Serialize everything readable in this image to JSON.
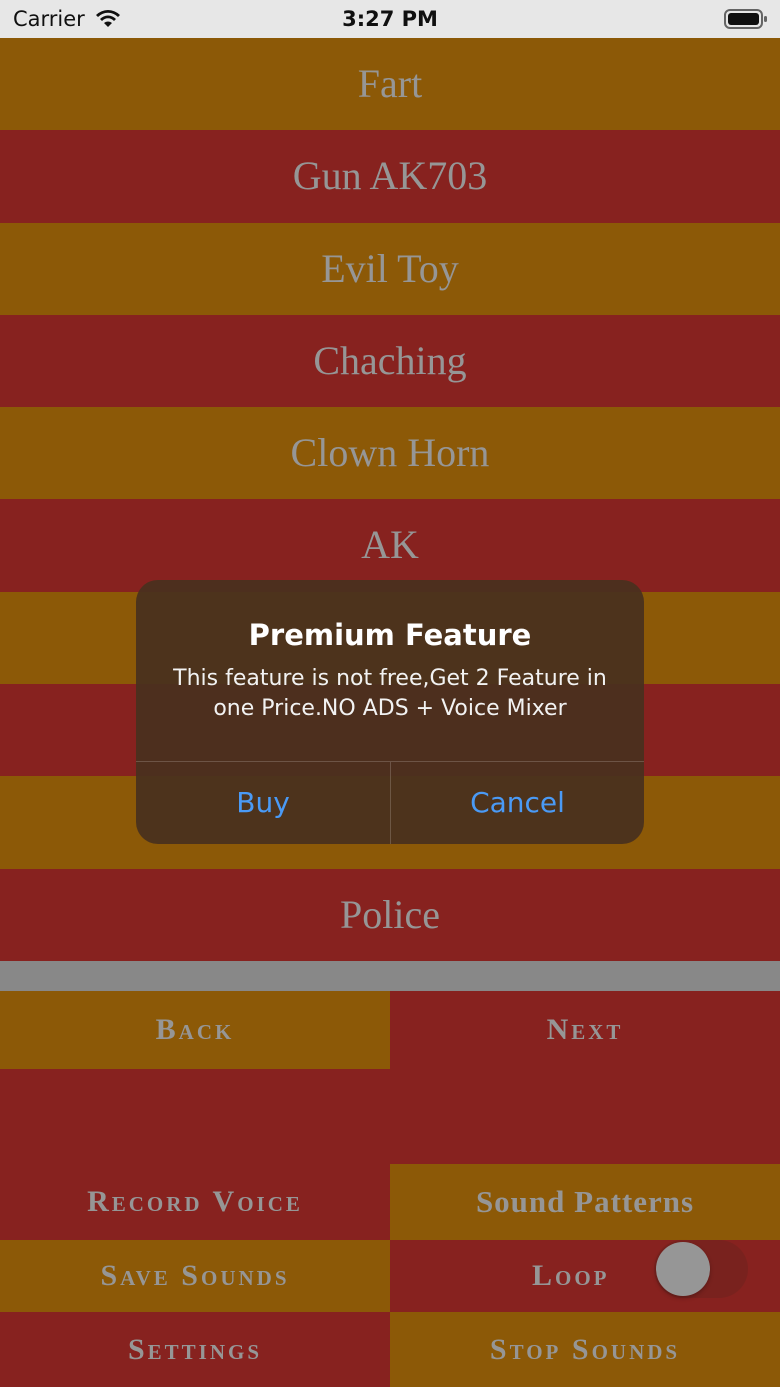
{
  "status_bar": {
    "carrier": "Carrier",
    "time": "3:27 PM"
  },
  "sounds": [
    {
      "label": "Fart",
      "style": "gold"
    },
    {
      "label": "Gun AK703",
      "style": "red"
    },
    {
      "label": "Evil Toy",
      "style": "gold"
    },
    {
      "label": "Chaching",
      "style": "red"
    },
    {
      "label": "Clown Horn",
      "style": "gold"
    },
    {
      "label": "AK",
      "style": "red"
    },
    {
      "label": "",
      "style": "gold"
    },
    {
      "label": "",
      "style": "red"
    },
    {
      "label": "",
      "style": "gold"
    },
    {
      "label": "Police",
      "style": "red"
    }
  ],
  "controls": {
    "back": "Back",
    "next": "Next",
    "record_voice": "Record Voice",
    "sound_patterns": "Sound Patterns",
    "save_sounds": "Save Sounds",
    "loop": "Loop",
    "loop_on": false,
    "settings": "Settings",
    "stop_sounds": "Stop Sounds"
  },
  "alert": {
    "title": "Premium Feature",
    "message": "This feature is not free,Get 2 Feature in one Price.NO ADS + Voice Mixer",
    "buy": "Buy",
    "cancel": "Cancel"
  },
  "colors": {
    "gold": "#8f5b08",
    "red": "#8a2320",
    "alert_button": "#4a9af5"
  }
}
